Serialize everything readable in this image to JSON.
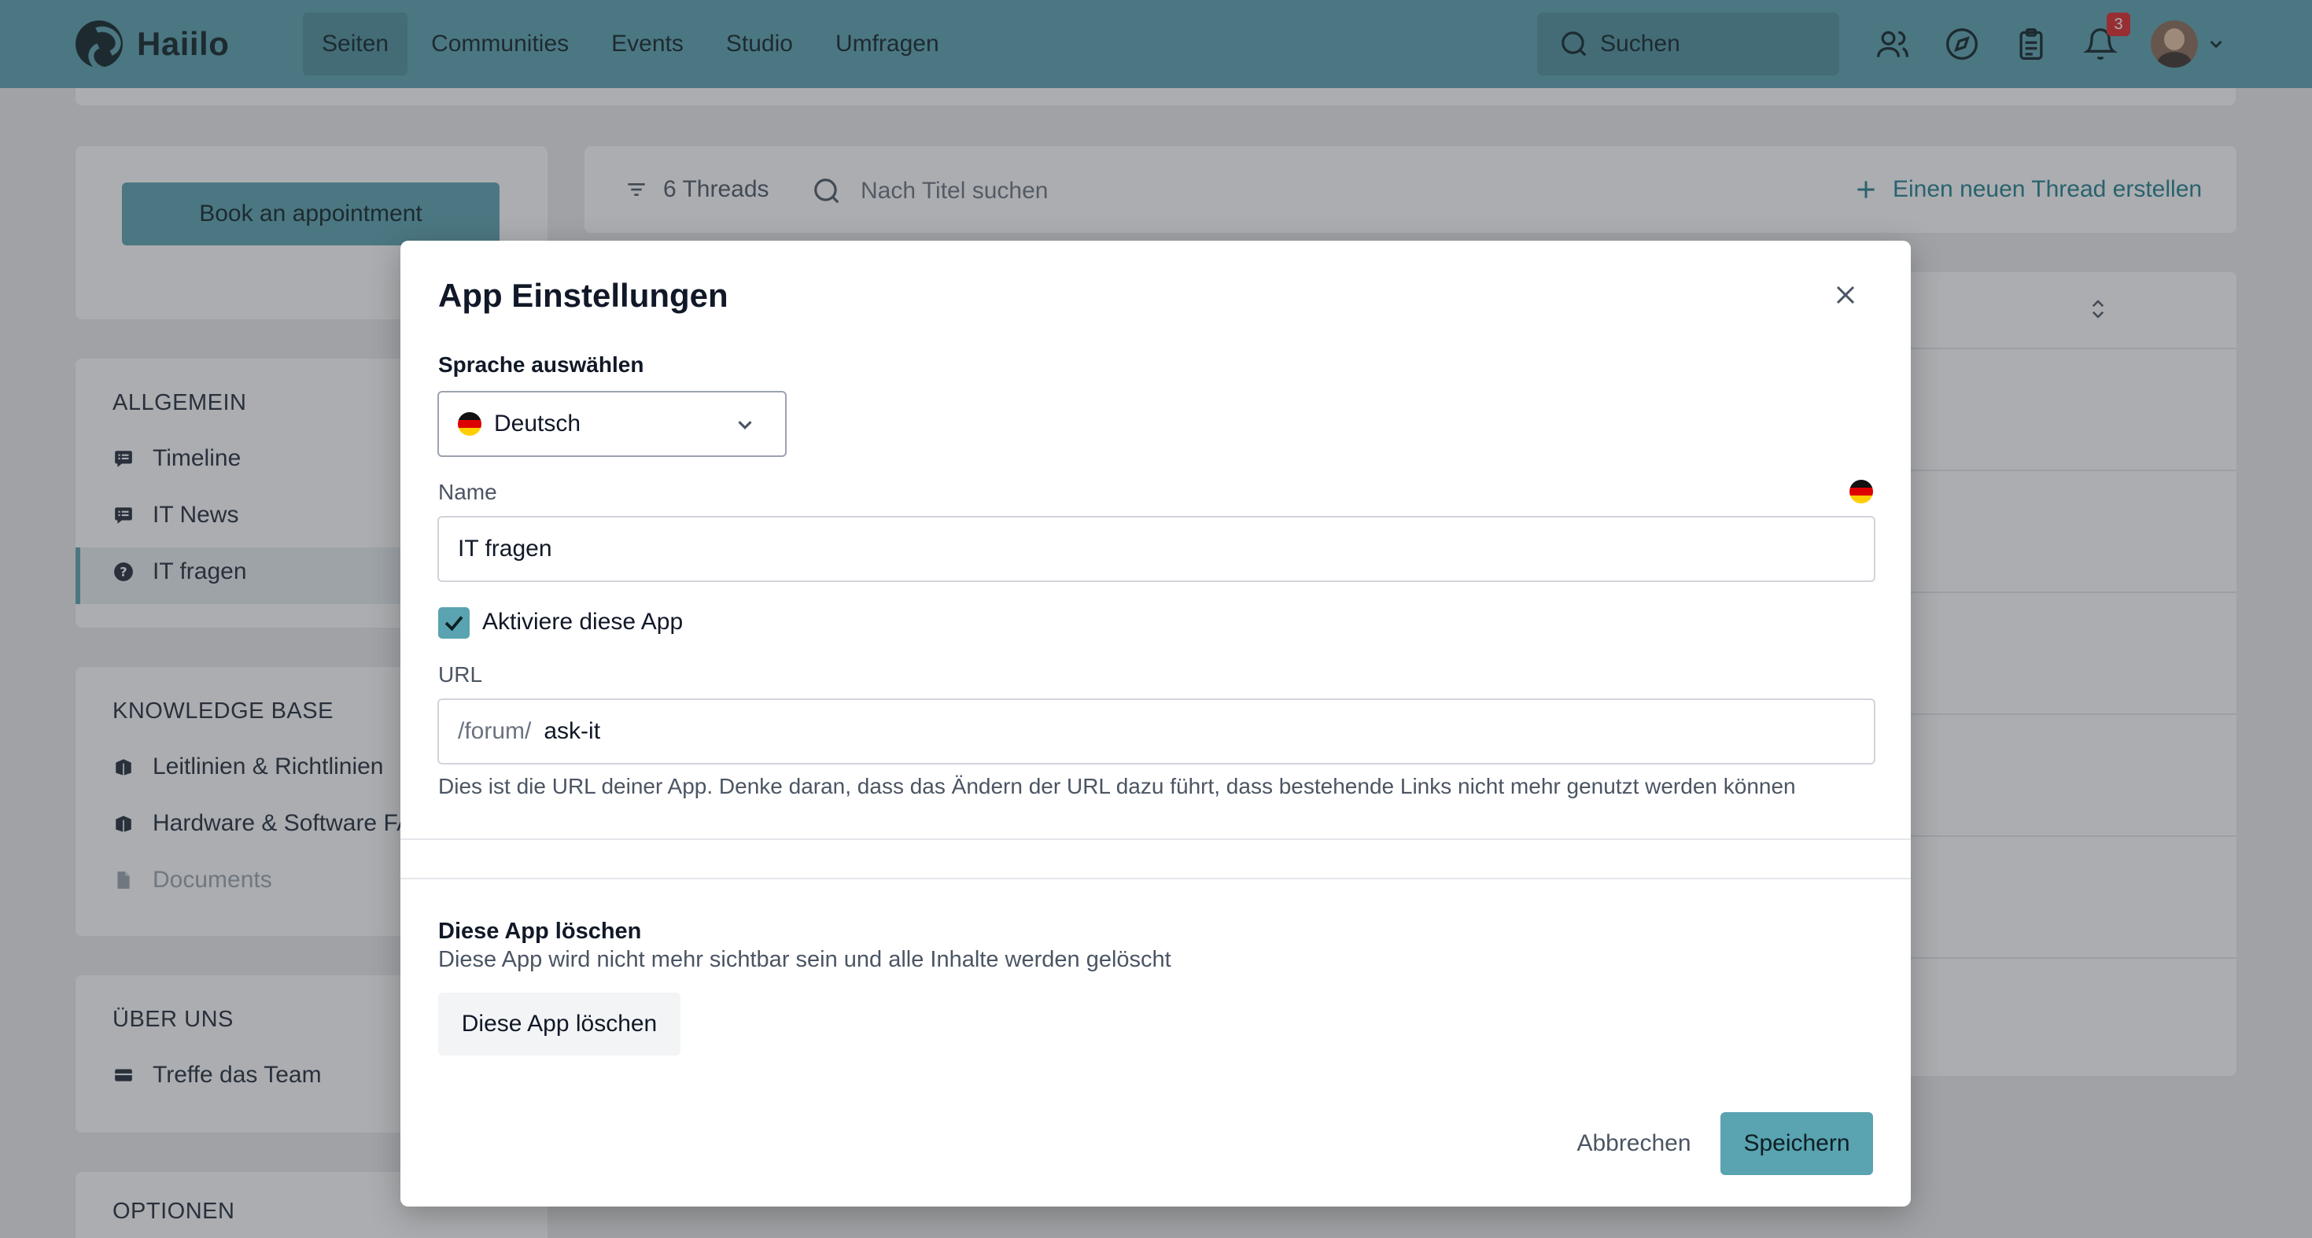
{
  "app": {
    "name": "Haiilo"
  },
  "nav": {
    "items": [
      "Seiten",
      "Communities",
      "Events",
      "Studio",
      "Umfragen"
    ],
    "active": "Seiten"
  },
  "search": {
    "placeholder": "Suchen"
  },
  "header_icons": [
    "people-icon",
    "compass-icon",
    "clipboard-icon",
    "bell-icon"
  ],
  "notifications": {
    "count": "3"
  },
  "sidebar": {
    "book_button": "Book an appointment",
    "sections": [
      {
        "title": "ALLGEMEIN",
        "items": [
          {
            "label": "Timeline",
            "icon": "timeline-icon"
          },
          {
            "label": "IT News",
            "icon": "news-icon"
          },
          {
            "label": "IT fragen",
            "icon": "question-icon",
            "active": true
          }
        ]
      },
      {
        "title": "KNOWLEDGE BASE",
        "items": [
          {
            "label": "Leitlinien & Richtlinien",
            "icon": "book-icon"
          },
          {
            "label": "Hardware & Software FA",
            "icon": "book-icon"
          },
          {
            "label": "Documents",
            "icon": "document-icon",
            "disabled": true
          }
        ]
      },
      {
        "title": "ÜBER UNS",
        "items": [
          {
            "label": "Treffe das Team",
            "icon": "team-icon"
          }
        ]
      },
      {
        "title": "OPTIONEN",
        "items": []
      }
    ]
  },
  "threads": {
    "count_label": "6 Threads",
    "search_placeholder": "Nach Titel suchen",
    "new_thread": "Einen neuen Thread erstellen"
  },
  "modal": {
    "title": "App Einstellungen",
    "language_label": "Sprache auswählen",
    "language_value": "Deutsch",
    "name_label": "Name",
    "name_value": "IT fragen",
    "activate_label": "Aktiviere diese App",
    "activate_checked": true,
    "url_label": "URL",
    "url_prefix": "/forum/",
    "url_value": "ask-it",
    "url_hint": "Dies ist die URL deiner App. Denke daran, dass das Ändern der URL dazu führt, dass bestehende Links nicht mehr genutzt werden können",
    "delete_title": "Diese App löschen",
    "delete_description": "Diese App wird nicht mehr sichtbar sein und alle Inhalte werden gelöscht",
    "delete_button": "Diese App löschen",
    "cancel_button": "Abbrechen",
    "save_button": "Speichern"
  },
  "colors": {
    "brand": "#5aa3b0",
    "brand_dark": "#0c1f24",
    "badge": "#dc2626"
  }
}
